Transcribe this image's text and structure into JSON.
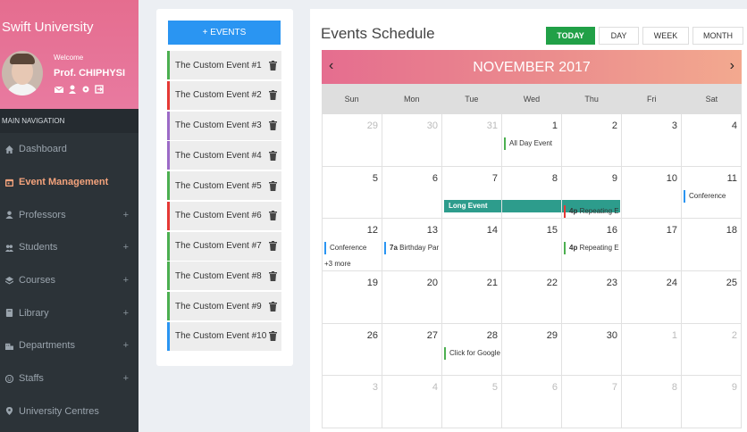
{
  "sidebar": {
    "brand": "Swift University",
    "welcome": "Welcome",
    "profile_name": "Prof. CHIPHYSI",
    "nav_header": "MAIN NAVIGATION",
    "items": [
      {
        "label": "Dashboard",
        "icon": "home-icon",
        "plus": ""
      },
      {
        "label": "Event Management",
        "icon": "calendar-icon",
        "plus": ""
      },
      {
        "label": "Professors",
        "icon": "user-icon",
        "plus": "+"
      },
      {
        "label": "Students",
        "icon": "users-icon",
        "plus": "+"
      },
      {
        "label": "Courses",
        "icon": "layers-icon",
        "plus": "+"
      },
      {
        "label": "Library",
        "icon": "book-icon",
        "plus": "+"
      },
      {
        "label": "Departments",
        "icon": "building-icon",
        "plus": "+"
      },
      {
        "label": "Staffs",
        "icon": "smile-icon",
        "plus": "+"
      },
      {
        "label": "University Centres",
        "icon": "pin-icon",
        "plus": ""
      }
    ]
  },
  "events_panel": {
    "add_label": "+ EVENTS",
    "events": [
      {
        "label": "The Custom Event #1",
        "color": "#4caf50"
      },
      {
        "label": "The Custom Event #2",
        "color": "#e53935"
      },
      {
        "label": "The Custom Event #3",
        "color": "#9c6bc7"
      },
      {
        "label": "The Custom Event #4",
        "color": "#9c6bc7"
      },
      {
        "label": "The Custom Event #5",
        "color": "#4caf50"
      },
      {
        "label": "The Custom Event #6",
        "color": "#e53935"
      },
      {
        "label": "The Custom Event #7",
        "color": "#4caf50"
      },
      {
        "label": "The Custom Event #8",
        "color": "#4caf50"
      },
      {
        "label": "The Custom Event #9",
        "color": "#4caf50"
      },
      {
        "label": "The Custom Event #10",
        "color": "#2a95f2"
      }
    ]
  },
  "calendar": {
    "title": "Events Schedule",
    "views": [
      "TODAY",
      "DAY",
      "WEEK",
      "MONTH"
    ],
    "month_label": "NOVEMBER 2017",
    "prev": "‹",
    "next": "›",
    "weekdays": [
      "Sun",
      "Mon",
      "Tue",
      "Wed",
      "Thu",
      "Fri",
      "Sat"
    ],
    "weeks": [
      [
        "29",
        "30",
        "31",
        "1",
        "2",
        "3",
        "4"
      ],
      [
        "5",
        "6",
        "7",
        "8",
        "9",
        "10",
        "11"
      ],
      [
        "12",
        "13",
        "14",
        "15",
        "16",
        "17",
        "18"
      ],
      [
        "19",
        "20",
        "21",
        "22",
        "23",
        "24",
        "25"
      ],
      [
        "26",
        "27",
        "28",
        "29",
        "30",
        "1",
        "2"
      ],
      [
        "3",
        "4",
        "5",
        "6",
        "7",
        "8",
        "9"
      ]
    ],
    "other_month": [
      [
        0,
        0
      ],
      [
        0,
        1
      ],
      [
        0,
        2
      ],
      [
        4,
        5
      ],
      [
        4,
        6
      ],
      [
        5,
        0
      ],
      [
        5,
        1
      ],
      [
        5,
        2
      ],
      [
        5,
        3
      ],
      [
        5,
        4
      ],
      [
        5,
        5
      ],
      [
        5,
        6
      ]
    ],
    "events": {
      "all_day": "All Day Event",
      "long": "Long Event",
      "repeat_time": "4p",
      "repeat_label": "Repeating E",
      "conference": "Conference",
      "birthday_time": "7a",
      "birthday_label": "Birthday Par",
      "more": "+3 more",
      "google": "Click for Google"
    },
    "colors": {
      "green": "#4caf50",
      "red": "#e53935",
      "blue": "#2a95f2",
      "teal": "#2d9c8c"
    }
  }
}
